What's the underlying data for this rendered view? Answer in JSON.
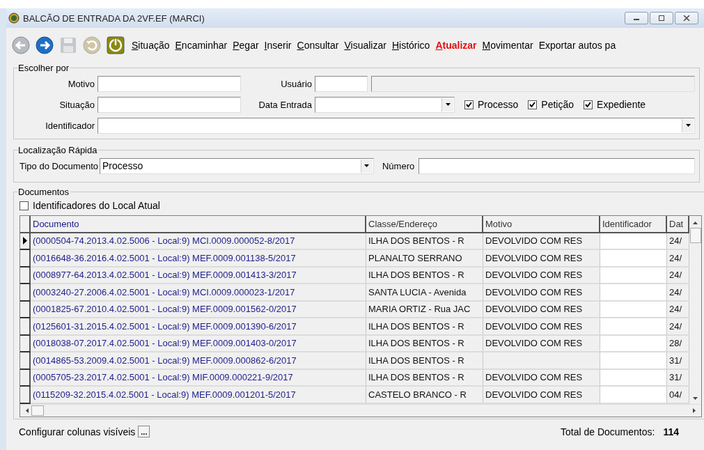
{
  "window": {
    "title": "BALCÃO DE ENTRADA DA 2VF.EF (MARCI)"
  },
  "toolbar": {
    "icon_buttons": [
      {
        "kind": "back",
        "disabled": true
      },
      {
        "kind": "forward",
        "disabled": false
      },
      {
        "kind": "save",
        "disabled": true
      },
      {
        "kind": "undo",
        "disabled": true
      },
      {
        "kind": "power",
        "disabled": false
      }
    ],
    "menu": [
      {
        "label": "Situação",
        "mnemonic": true,
        "highlighted": false
      },
      {
        "label": "Encaminhar",
        "mnemonic": true,
        "highlighted": false
      },
      {
        "label": "Pegar",
        "mnemonic": true,
        "highlighted": false
      },
      {
        "label": "Inserir",
        "mnemonic": true,
        "highlighted": false
      },
      {
        "label": "Consultar",
        "mnemonic": true,
        "highlighted": false
      },
      {
        "label": "Visualizar",
        "mnemonic": true,
        "highlighted": false
      },
      {
        "label": "Histórico",
        "mnemonic": true,
        "highlighted": false
      },
      {
        "label": "Atualizar",
        "mnemonic": true,
        "highlighted": true
      },
      {
        "label": "Movimentar",
        "mnemonic": true,
        "highlighted": false
      },
      {
        "label": "Exportar autos pa",
        "mnemonic": false,
        "highlighted": false
      }
    ]
  },
  "filter": {
    "title": "Escolher por",
    "motivo": {
      "label": "Motivo"
    },
    "usuario": {
      "label": "Usuário"
    },
    "situacao": {
      "label": "Situação"
    },
    "data_entrada": {
      "label": "Data Entrada"
    },
    "types": [
      {
        "label": "Processo",
        "checked": true
      },
      {
        "label": "Petição",
        "checked": true
      },
      {
        "label": "Expediente",
        "checked": true
      }
    ],
    "identificador": {
      "label": "Identificador"
    }
  },
  "quick_locate": {
    "title": "Localização Rápida",
    "document_type": {
      "label": "Tipo do Documento",
      "value": "Processo"
    },
    "number": {
      "label": "Número"
    }
  },
  "documents": {
    "title": "Documentos",
    "local_filter": {
      "label": "Identificadores do Local Atual",
      "checked": false
    },
    "table": {
      "columns": [
        "Documento",
        "Classe/Endereço",
        "Motivo",
        "Identificador",
        "Dat"
      ],
      "rows": [
        {
          "selected": true,
          "documento": "(0000504-74.2013.4.02.5006 - Local:9) MCI.0009.000052-8/2017",
          "classe": "ILHA DOS BENTOS - R",
          "motivo": "DEVOLVIDO COM RES",
          "data": "24/"
        },
        {
          "selected": false,
          "documento": "(0016648-36.2016.4.02.5001 - Local:9) MEF.0009.001138-5/2017",
          "classe": "PLANALTO SERRANO",
          "motivo": "DEVOLVIDO COM RES",
          "data": "24/"
        },
        {
          "selected": false,
          "documento": "(0008977-64.2013.4.02.5001 - Local:9) MEF.0009.001413-3/2017",
          "classe": "ILHA DOS BENTOS - R",
          "motivo": "DEVOLVIDO COM RES",
          "data": "24/"
        },
        {
          "selected": false,
          "documento": "(0003240-27.2006.4.02.5001 - Local:9) MCI.0009.000023-1/2017",
          "classe": "SANTA LUCIA - Avenida",
          "motivo": "DEVOLVIDO COM RES",
          "data": "24/"
        },
        {
          "selected": false,
          "documento": "(0001825-67.2010.4.02.5001 - Local:9) MEF.0009.001562-0/2017",
          "classe": "MARIA ORTIZ - Rua JAC",
          "motivo": "DEVOLVIDO COM RES",
          "data": "24/"
        },
        {
          "selected": false,
          "documento": "(0125601-31.2015.4.02.5001 - Local:9) MEF.0009.001390-6/2017",
          "classe": "ILHA DOS BENTOS - R",
          "motivo": "DEVOLVIDO COM RES",
          "data": "24/"
        },
        {
          "selected": false,
          "documento": "(0018038-07.2017.4.02.5001 - Local:9) MEF.0009.001403-0/2017",
          "classe": "ILHA DOS BENTOS - R",
          "motivo": "DEVOLVIDO COM RES",
          "data": "28/"
        },
        {
          "selected": false,
          "documento": "(0014865-53.2009.4.02.5001 - Local:9) MEF.0009.000862-6/2017",
          "classe": "ILHA DOS BENTOS - R",
          "data": "31/"
        },
        {
          "selected": false,
          "documento": "(0005705-23.2017.4.02.5001 - Local:9) MIF.0009.000221-9/2017",
          "classe": "ILHA DOS BENTOS - R",
          "motivo": "DEVOLVIDO COM RES",
          "data": "31/"
        },
        {
          "selected": false,
          "documento": "(0115209-32.2015.4.02.5001 - Local:9) MEF.0009.001201-5/2017",
          "classe": "CASTELO BRANCO - R",
          "motivo": "DEVOLVIDO COM RES",
          "data": "04/"
        }
      ]
    }
  },
  "footer": {
    "configure_columns": {
      "label": "Configurar colunas visíveis",
      "button": "..."
    },
    "total": {
      "label": "Total de Documentos:",
      "value": "114"
    }
  }
}
